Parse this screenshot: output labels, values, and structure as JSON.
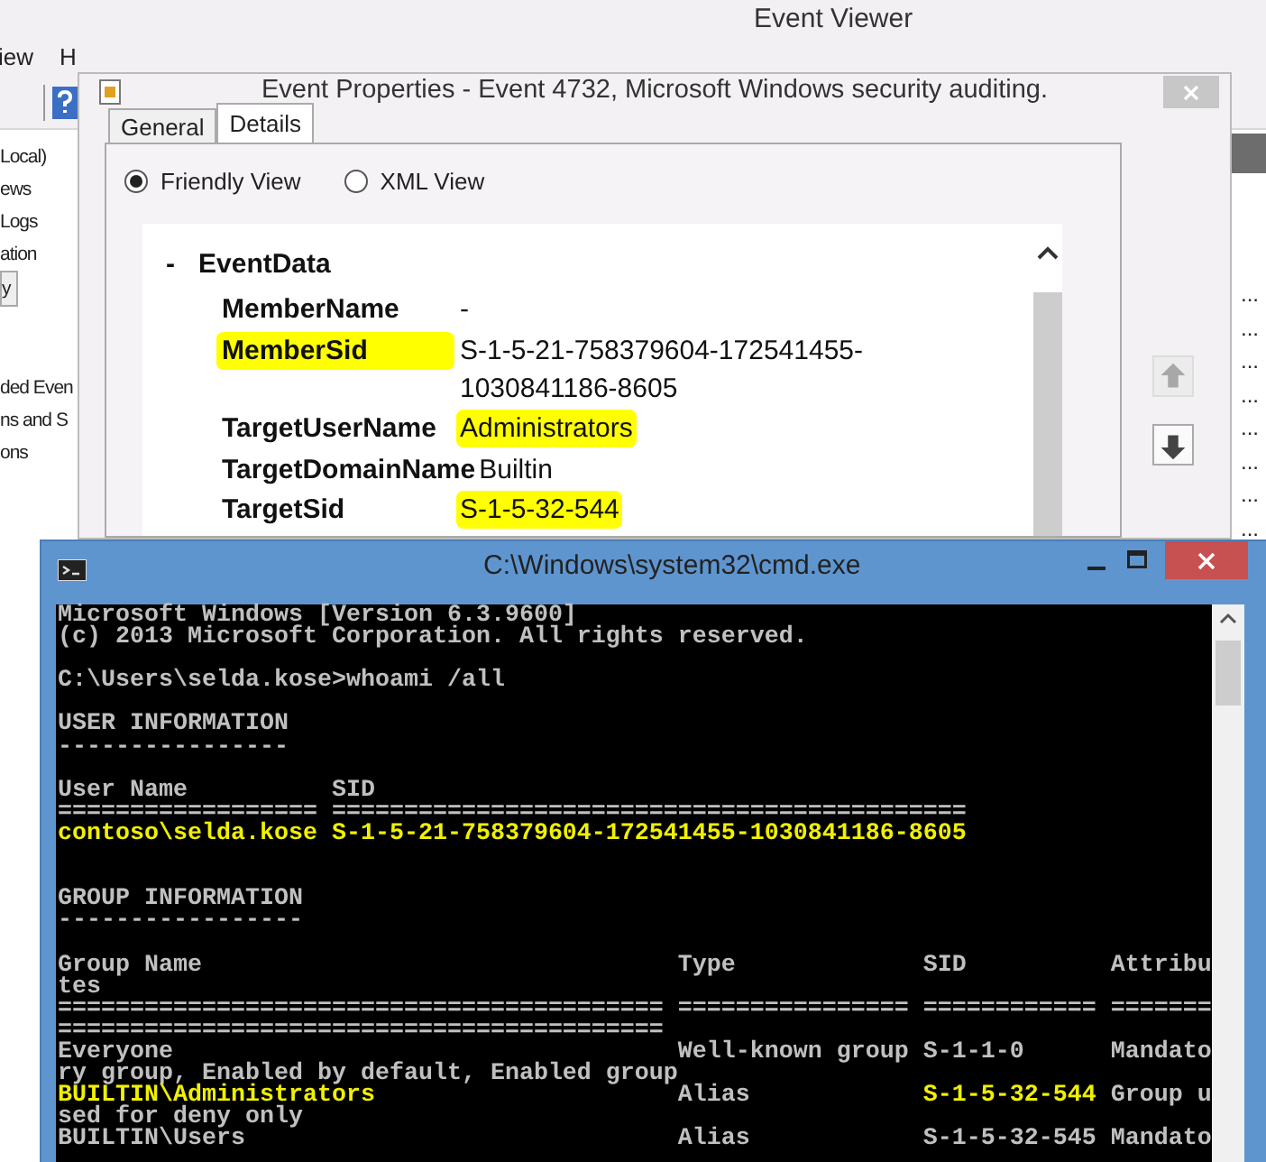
{
  "event_viewer": {
    "title": "Event Viewer",
    "menu": [
      "iew",
      "H"
    ],
    "tree": [
      {
        "label": "Local)",
        "selected": false
      },
      {
        "label": "ews",
        "selected": false
      },
      {
        "label": "Logs",
        "selected": false
      },
      {
        "label": "ation",
        "selected": false
      },
      {
        "label": "y",
        "selected": true
      },
      {
        "label": "ded Even",
        "selected": false
      },
      {
        "label": "ns and S",
        "selected": false
      },
      {
        "label": "ons",
        "selected": false
      }
    ],
    "list_rows": [
      "...",
      "...",
      "...",
      "...",
      "...",
      "...",
      "...",
      "..."
    ]
  },
  "dialog": {
    "title": "Event Properties - Event 4732, Microsoft Windows security auditing.",
    "tabs": [
      {
        "label": "General",
        "selected": false
      },
      {
        "label": "Details",
        "selected": true
      }
    ],
    "views": [
      {
        "label": "Friendly View",
        "selected": true
      },
      {
        "label": "XML View",
        "selected": false
      }
    ],
    "section": {
      "toggle": "-",
      "title": "EventData",
      "fields": [
        {
          "name": "MemberName",
          "value": "-",
          "name_highlighted": false,
          "value_highlighted": false
        },
        {
          "name": "MemberSid",
          "value": "S-1-5-21-758379604-172541455-1030841186-8605",
          "name_highlighted": true,
          "value_highlighted": false
        },
        {
          "name": "TargetUserName",
          "value": "Administrators",
          "name_highlighted": false,
          "value_highlighted": true
        },
        {
          "name": "TargetDomainName",
          "value": "Builtin",
          "name_highlighted": false,
          "value_highlighted": false
        },
        {
          "name": "TargetSid",
          "value": "S-1-5-32-544",
          "name_highlighted": false,
          "value_highlighted": true
        }
      ]
    },
    "nav_buttons": [
      {
        "kind": "up",
        "disabled": true
      },
      {
        "kind": "down",
        "disabled": false
      }
    ]
  },
  "console": {
    "title": "C:\\Windows\\system32\\cmd.exe",
    "lines": [
      {
        "kind": "text",
        "segments": [
          {
            "text": "Microsoft Windows [Version 6.3.9600]",
            "highlighted": false
          }
        ]
      },
      {
        "kind": "text",
        "segments": [
          {
            "text": "(c) 2013 Microsoft Corporation. All rights reserved.",
            "highlighted": false
          }
        ]
      },
      {
        "kind": "blank"
      },
      {
        "kind": "text",
        "segments": [
          {
            "text": "C:\\Users\\selda.kose>whoami /all",
            "highlighted": false
          }
        ]
      },
      {
        "kind": "blank"
      },
      {
        "kind": "text",
        "segments": [
          {
            "text": "USER INFORMATION",
            "highlighted": false
          }
        ]
      },
      {
        "kind": "text",
        "segments": [
          {
            "text": "----------------",
            "highlighted": false
          }
        ]
      },
      {
        "kind": "blank"
      },
      {
        "kind": "text",
        "segments": [
          {
            "text": "User Name          SID",
            "highlighted": false
          }
        ]
      },
      {
        "kind": "text",
        "segments": [
          {
            "text": "================== ============================================",
            "highlighted": false
          }
        ]
      },
      {
        "kind": "text",
        "segments": [
          {
            "text": "contoso\\selda.kose S-1-5-21-758379604-172541455-1030841186-8605",
            "highlighted": true
          }
        ]
      },
      {
        "kind": "blank"
      },
      {
        "kind": "blank"
      },
      {
        "kind": "text",
        "segments": [
          {
            "text": "GROUP INFORMATION",
            "highlighted": false
          }
        ]
      },
      {
        "kind": "text",
        "segments": [
          {
            "text": "-----------------",
            "highlighted": false
          }
        ]
      },
      {
        "kind": "blank"
      },
      {
        "kind": "text",
        "segments": [
          {
            "text": "Group Name                                 Type             SID          Attribu",
            "highlighted": false
          }
        ]
      },
      {
        "kind": "text",
        "segments": [
          {
            "text": "tes",
            "highlighted": false
          }
        ]
      },
      {
        "kind": "text",
        "segments": [
          {
            "text": "========================================== ================ ============ =======",
            "highlighted": false
          }
        ]
      },
      {
        "kind": "text",
        "segments": [
          {
            "text": "==========================================",
            "highlighted": false
          }
        ]
      },
      {
        "kind": "text",
        "segments": [
          {
            "text": "Everyone                                   Well-known group S-1-1-0      Mandato",
            "highlighted": false
          }
        ]
      },
      {
        "kind": "text",
        "segments": [
          {
            "text": "ry group, Enabled by default, Enabled group",
            "highlighted": false
          }
        ]
      },
      {
        "kind": "text",
        "segments": [
          {
            "text": "BUILTIN\\Administrators",
            "highlighted": true
          },
          {
            "text": "                     Alias            ",
            "highlighted": false
          },
          {
            "text": "S-1-5-32-544",
            "highlighted": true
          },
          {
            "text": " Group u",
            "highlighted": false
          }
        ]
      },
      {
        "kind": "text",
        "segments": [
          {
            "text": "sed for deny only",
            "highlighted": false
          }
        ]
      },
      {
        "kind": "text",
        "segments": [
          {
            "text": "BUILTIN\\Users                              Alias            S-1-5-32-545 Mandato",
            "highlighted": false
          }
        ]
      }
    ]
  }
}
